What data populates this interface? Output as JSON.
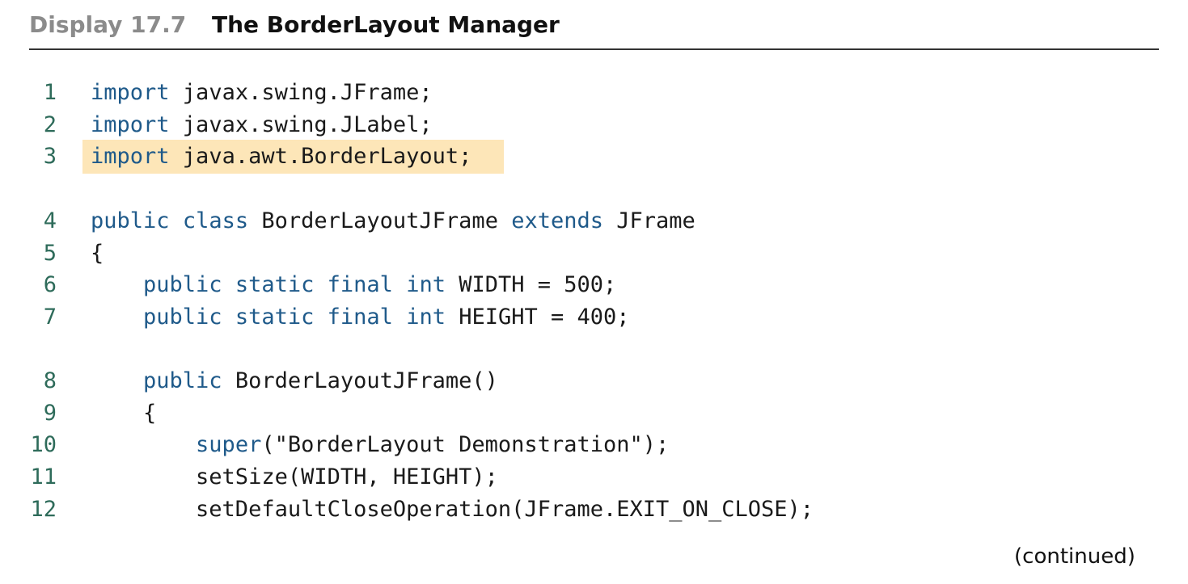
{
  "header": {
    "display_label": "Display 17.7",
    "title": "The BorderLayout Manager"
  },
  "highlight_color": "#fde6b8",
  "keyword_color": "#1f5a8a",
  "line_number_color": "#2e6b5a",
  "code": {
    "lines": [
      {
        "no": "1",
        "parts": [
          {
            "kw": "import"
          },
          {
            "t": " javax.swing.JFrame;"
          }
        ]
      },
      {
        "no": "2",
        "parts": [
          {
            "kw": "import"
          },
          {
            "t": " javax.swing.JLabel;"
          }
        ]
      },
      {
        "no": "3",
        "parts": [
          {
            "kw": "import"
          },
          {
            "t": " java.awt.BorderLayout;"
          }
        ]
      },
      {
        "no": "4",
        "parts": [
          {
            "kw": "public"
          },
          {
            "t": " "
          },
          {
            "kw": "class"
          },
          {
            "t": " BorderLayoutJFrame "
          },
          {
            "kw": "extends"
          },
          {
            "t": " JFrame"
          }
        ]
      },
      {
        "no": "5",
        "parts": [
          {
            "t": "{"
          }
        ]
      },
      {
        "no": "6",
        "parts": [
          {
            "t": "    "
          },
          {
            "kw": "public"
          },
          {
            "t": " "
          },
          {
            "kw": "static"
          },
          {
            "t": " "
          },
          {
            "kw": "final"
          },
          {
            "t": " "
          },
          {
            "kw": "int"
          },
          {
            "t": " WIDTH = 500;"
          }
        ]
      },
      {
        "no": "7",
        "parts": [
          {
            "t": "    "
          },
          {
            "kw": "public"
          },
          {
            "t": " "
          },
          {
            "kw": "static"
          },
          {
            "t": " "
          },
          {
            "kw": "final"
          },
          {
            "t": " "
          },
          {
            "kw": "int"
          },
          {
            "t": " HEIGHT = 400;"
          }
        ]
      },
      {
        "no": "8",
        "parts": [
          {
            "t": "    "
          },
          {
            "kw": "public"
          },
          {
            "t": " BorderLayoutJFrame()"
          }
        ]
      },
      {
        "no": "9",
        "parts": [
          {
            "t": "    {"
          }
        ]
      },
      {
        "no": "10",
        "parts": [
          {
            "t": "        "
          },
          {
            "kw": "super"
          },
          {
            "t": "(\"BorderLayout Demonstration\");"
          }
        ]
      },
      {
        "no": "11",
        "parts": [
          {
            "t": "        setSize(WIDTH, HEIGHT);"
          }
        ]
      },
      {
        "no": "12",
        "parts": [
          {
            "t": "        setDefaultCloseOperation(JFrame.EXIT_ON_CLOSE);"
          }
        ]
      }
    ]
  },
  "footer": {
    "continued": "(continued)"
  }
}
